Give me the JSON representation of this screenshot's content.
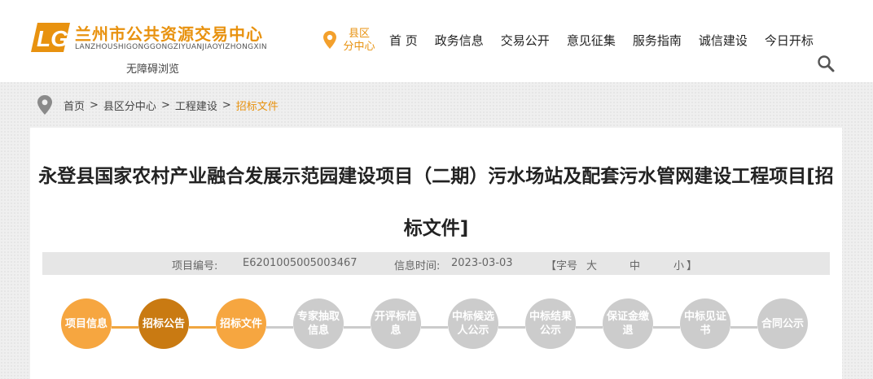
{
  "header": {
    "logo_cn": "兰州市公共资源交易中心",
    "logo_en": "LANZHOUSHIGONGGONGZIYUANJIAOYIZHONGXIN",
    "accessibility": "无障碍浏览",
    "region_line1": "县区",
    "region_line2": "分中心",
    "nav": [
      "首 页",
      "政务信息",
      "交易公开",
      "意见征集",
      "服务指南",
      "诚信建设",
      "今日开标"
    ]
  },
  "breadcrumb": {
    "items": [
      "首页",
      "县区分中心",
      "工程建设"
    ],
    "separator": ">",
    "current": "招标文件"
  },
  "article": {
    "title": "永登县国家农村产业融合发展示范园建设项目（二期）污水场站及配套污水管网建设工程项目[招标文件]",
    "project_no_label": "项目编号:",
    "project_no": "E6201005005003467",
    "info_time_label": "信息时间:",
    "info_time": "2023-03-03",
    "font_size_prefix": "【字号",
    "font_large": "大",
    "font_medium": "中",
    "font_small": "小",
    "font_size_suffix": "】"
  },
  "steps": [
    {
      "label": "项目信息",
      "state": "done"
    },
    {
      "label": "招标公告",
      "state": "active"
    },
    {
      "label": "招标文件",
      "state": "done"
    },
    {
      "label": "专家抽取信息",
      "state": "todo"
    },
    {
      "label": "开评标信息",
      "state": "todo"
    },
    {
      "label": "中标候选人公示",
      "state": "todo"
    },
    {
      "label": "中标结果公示",
      "state": "todo"
    },
    {
      "label": "保证金缴退",
      "state": "todo"
    },
    {
      "label": "中标见证书",
      "state": "todo"
    },
    {
      "label": "合同公示",
      "state": "todo"
    }
  ],
  "colors": {
    "brand_orange": "#e8920f",
    "step_done": "#f6a640",
    "step_active": "#c97a12",
    "step_todo": "#cccccc"
  },
  "icons": [
    "logo-mark-icon",
    "location-pin-icon",
    "search-icon",
    "breadcrumb-pin-icon"
  ]
}
